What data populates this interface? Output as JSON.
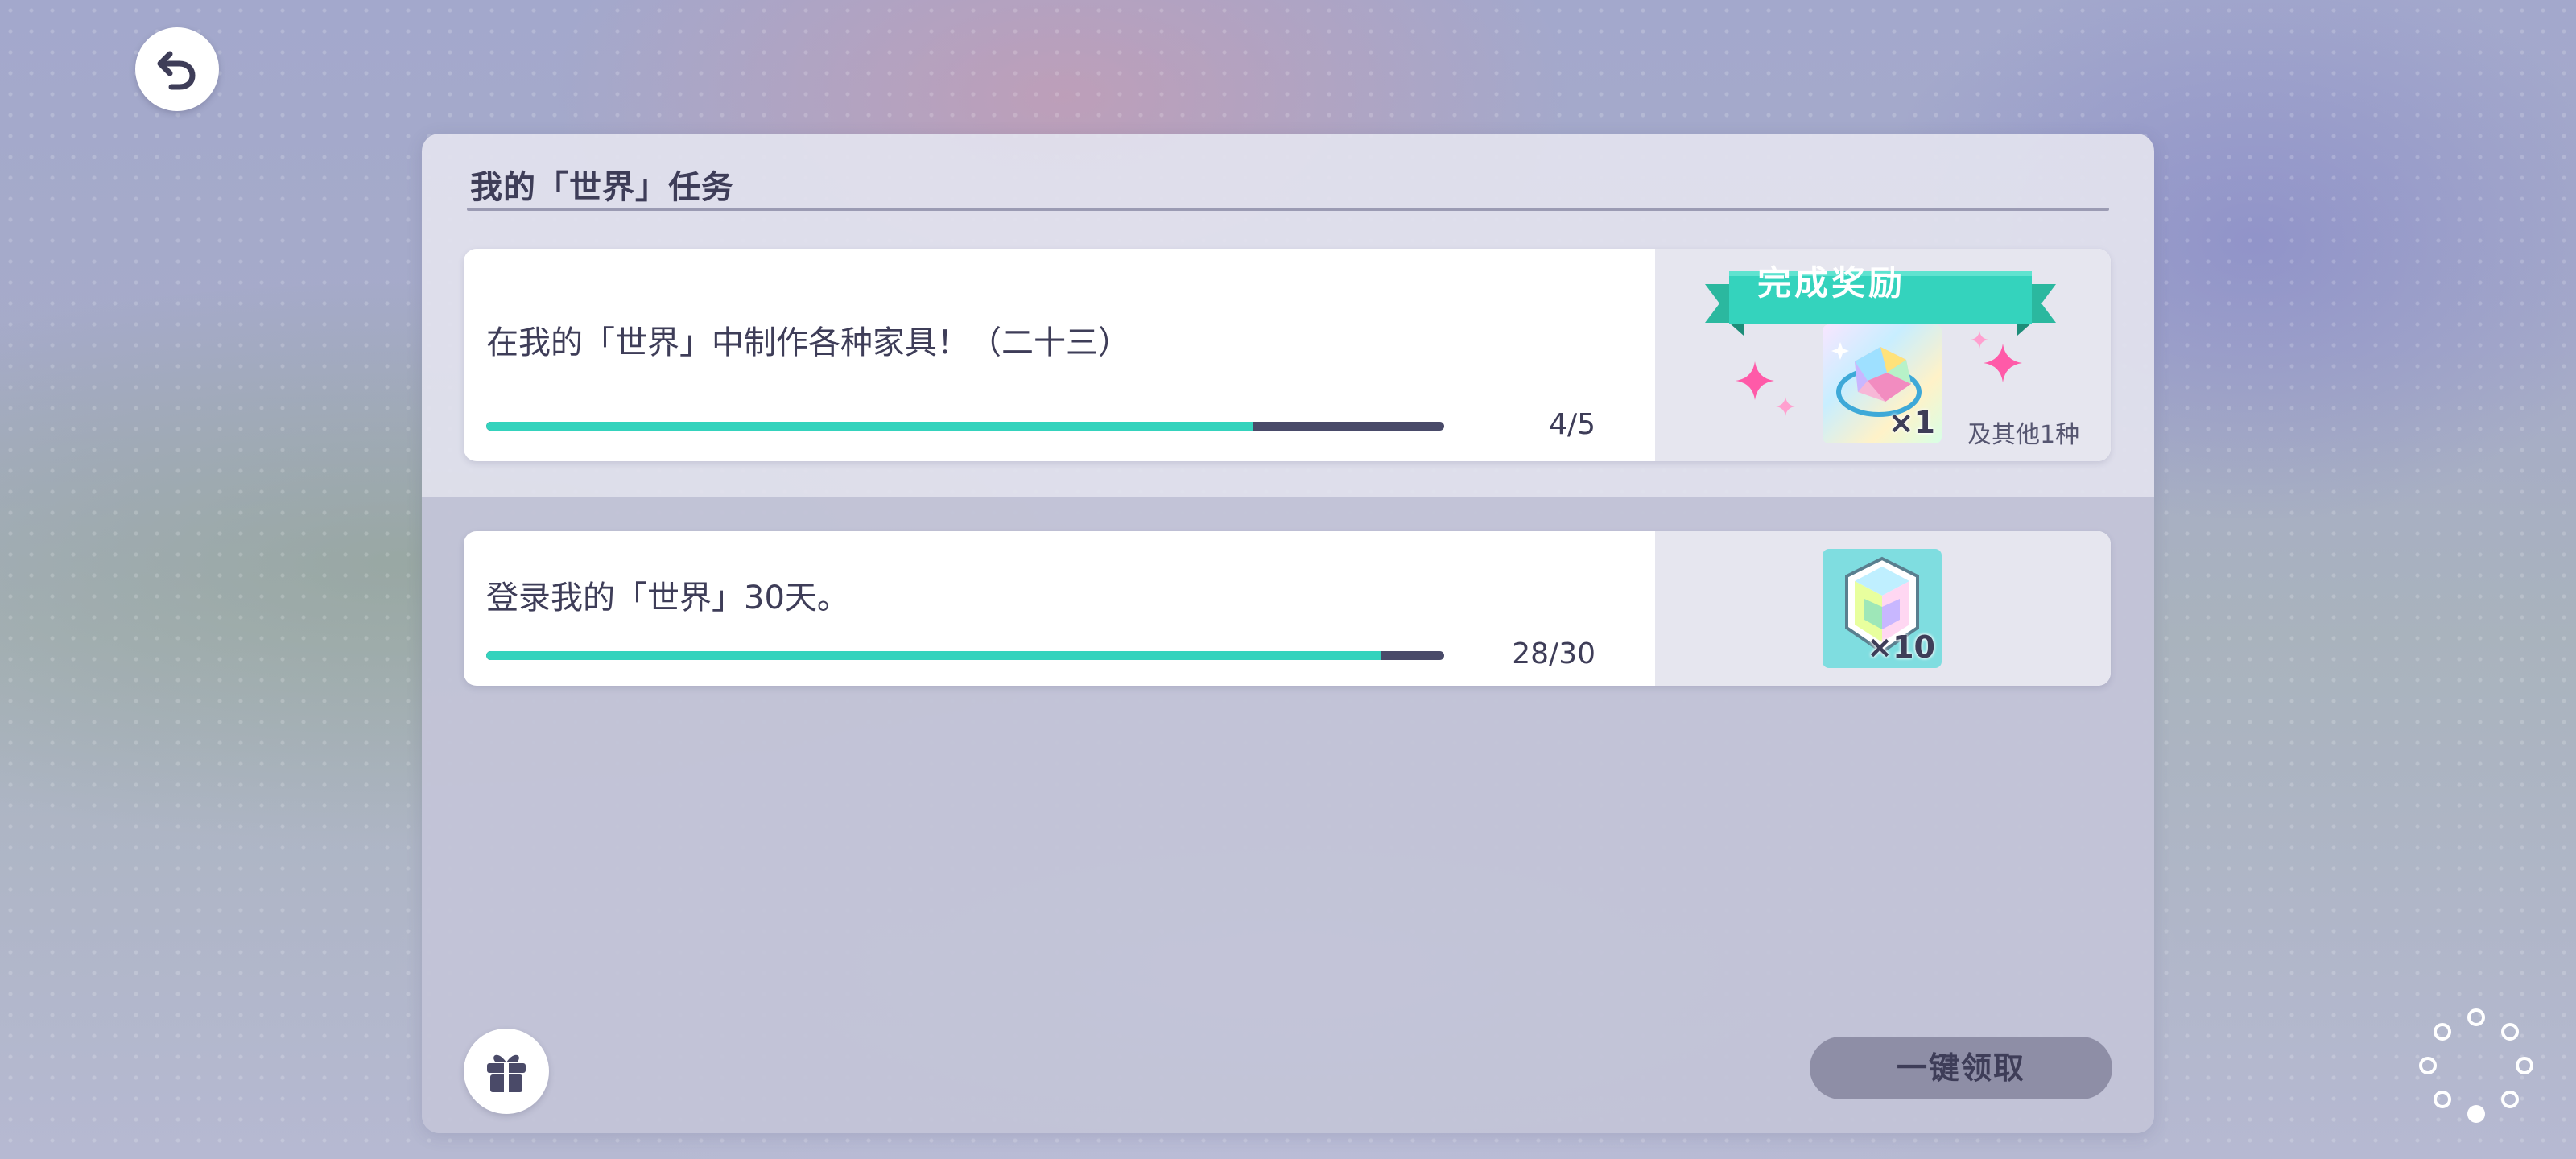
{
  "panel": {
    "title": "我的「世界」任务"
  },
  "tasks": [
    {
      "text": "在我的「世界」中制作各种家具！（二十三）",
      "progress_current": 4,
      "progress_total": 5,
      "progress_label": "4/5",
      "reward": {
        "badge_label": "完成奖励",
        "icon": "rainbow-crystal-ring-icon",
        "quantity_label": "×1",
        "others_label": "及其他1种"
      }
    },
    {
      "text": "登录我的「世界」30天。",
      "progress_current": 28,
      "progress_total": 30,
      "progress_label": "28/30",
      "reward": {
        "icon": "rainbow-gem-icon",
        "quantity_label": "×10"
      }
    }
  ],
  "footer": {
    "gift_icon": "gift-icon",
    "claim_all_label": "一键领取"
  },
  "colors": {
    "accent": "#34d3bd",
    "bar_track": "#494a69",
    "text": "#3e3d58",
    "sparkle": "#ff5aa8",
    "claim_button": "#8e8ea6"
  }
}
